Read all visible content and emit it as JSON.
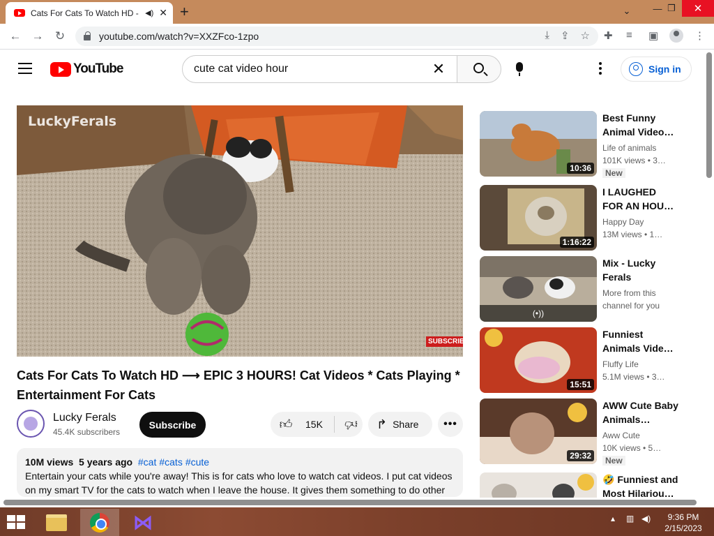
{
  "browser": {
    "tab_title": "Cats For Cats To Watch HD -",
    "audio_icon": "speaker-icon",
    "url": "youtube.com/watch?v=XXZFco-1zpo"
  },
  "header": {
    "logo_text": "YouTube",
    "search_query": "cute cat video hour",
    "signin_label": "Sign in"
  },
  "player": {
    "watermark": "LuckyFerals",
    "subscribe_badge": "SUBSCRIBE"
  },
  "video": {
    "title": "Cats For Cats To Watch HD ⟶ EPIC 3 HOURS! Cat Videos * Cats Playing * Entertainment For Cats",
    "channel": "Lucky Ferals",
    "subscribers": "45.4K subscribers",
    "subscribe_label": "Subscribe",
    "likes": "15K",
    "share_label": "Share",
    "more_label": "•••",
    "views": "10M views",
    "age": "5 years ago",
    "tags": [
      "#cat",
      "#cats",
      "#cute"
    ],
    "description": "Entertain your cats while you're away! This is for cats who love to watch cat videos. I put cat videos on my smart TV for the cats to watch when I leave the house. It gives them something to do other"
  },
  "sidebar": {
    "items": [
      {
        "title": "Best Funny Animal Video…",
        "channel": "Life of animals",
        "views": "101K views • 3…",
        "duration": "10:36",
        "badge": "New",
        "colors": [
          "#9a8a74",
          "#d9c7a3",
          "#c87a3a"
        ]
      },
      {
        "title": "I LAUGHED FOR AN HOUR😹…",
        "channel": "Happy Day",
        "views": "13M views • 1…",
        "duration": "1:16:22",
        "badge": "",
        "colors": [
          "#5b4a3a",
          "#c8b58a",
          "#8a7a60"
        ]
      },
      {
        "title": "Mix - Lucky Ferals",
        "channel": "More from this channel for you",
        "views": "",
        "duration": "",
        "badge": "",
        "mix_icon": "(•))",
        "colors": [
          "#7d7366",
          "#b9ae9c",
          "#3a3a3a"
        ]
      },
      {
        "title": "Funniest Animals Vide…",
        "channel": "Fluffy Life",
        "views": "5.1M views • 3…",
        "duration": "15:51",
        "badge": "",
        "colors": [
          "#c0391f",
          "#e9b8d0",
          "#f0c070"
        ]
      },
      {
        "title": "AWW Cute Baby Animals…",
        "channel": "Aww Cute",
        "views": "10K views • 5…",
        "duration": "29:32",
        "badge": "New",
        "colors": [
          "#5a3a2a",
          "#b8927a",
          "#e8d8c8"
        ]
      },
      {
        "title": "🤣 Funniest and Most Hilariou…",
        "channel": "",
        "views": "",
        "duration": "",
        "badge": "",
        "colors": [
          "#e9e4de",
          "#b8b0a6",
          "#888"
        ]
      }
    ]
  },
  "taskbar": {
    "time": "9:36 PM",
    "date": "2/15/2023"
  }
}
